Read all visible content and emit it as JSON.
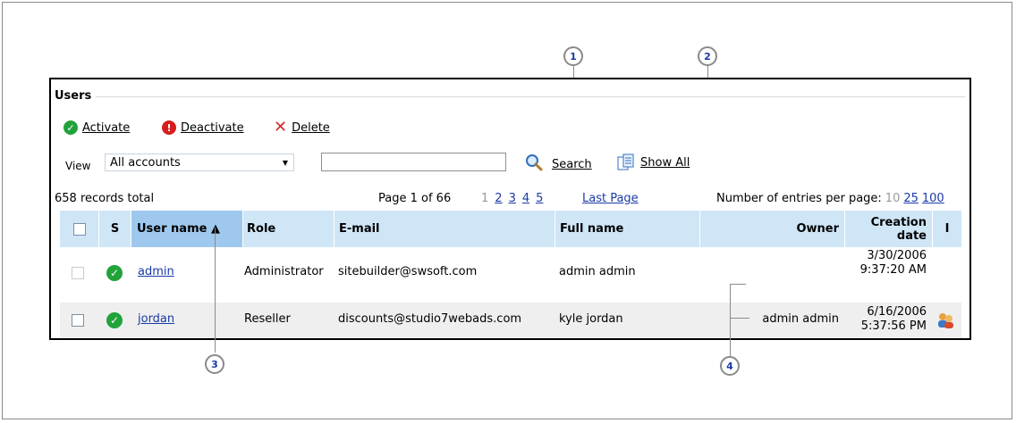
{
  "panel_title": "Users",
  "toolbar": {
    "activate": "Activate",
    "deactivate": "Deactivate",
    "delete": "Delete"
  },
  "filter": {
    "view_label": "View",
    "view_value": "All accounts",
    "search_value": "",
    "search_label": "Search",
    "show_all_label": "Show All"
  },
  "paging": {
    "records_total": "658 records total",
    "page_info": "Page 1 of 66",
    "pages": [
      "1",
      "2",
      "3",
      "4",
      "5"
    ],
    "current_page": "1",
    "last_page": "Last Page",
    "per_page_label": "Number of entries per page:",
    "per_page_options": [
      "10",
      "25",
      "100"
    ],
    "per_page_current": "10"
  },
  "table": {
    "columns": {
      "status": "S",
      "username": "User name ▲",
      "role": "Role",
      "email": "E-mail",
      "fullname": "Full name",
      "owner": "Owner",
      "created": "Creation date",
      "icon": "I"
    },
    "rows": [
      {
        "username": "admin",
        "role": "Administrator",
        "email": "sitebuilder@swsoft.com",
        "fullname": "admin admin",
        "owner": "",
        "created": "3/30/2006 9:37:20 AM"
      },
      {
        "username": "jordan",
        "role": "Reseller",
        "email": "discounts@studio7webads.com",
        "fullname": "kyle jordan",
        "owner": "admin admin",
        "created": "6/16/2006 5:37:56 PM"
      }
    ]
  },
  "callouts": [
    "1",
    "2",
    "3",
    "4"
  ],
  "colors": {
    "header_bg": "#cfe6f7",
    "sorted_header_bg": "#9fc8ee",
    "link": "#1a3aa5",
    "status_green": "#21a33a",
    "deactivate_red": "#d51e1e"
  }
}
